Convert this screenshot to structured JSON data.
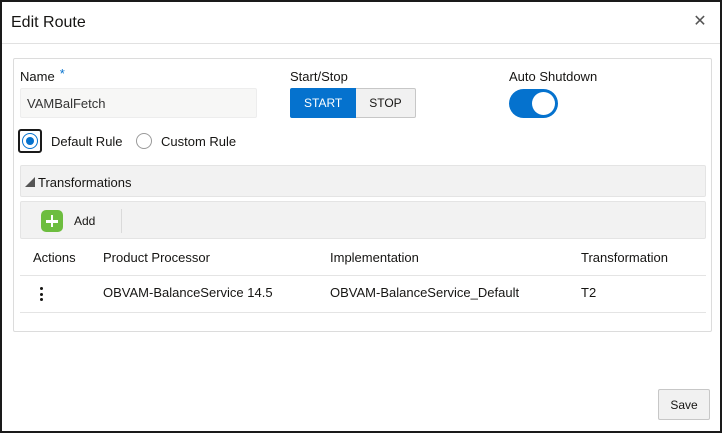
{
  "dialog": {
    "title": "Edit Route",
    "close_icon": "close-icon",
    "close_glyph": "✕"
  },
  "form": {
    "name_label": "Name",
    "required_mark": "*",
    "name_value": "VAMBalFetch",
    "start_stop_label": "Start/Stop",
    "start_label": "START",
    "stop_label": "STOP",
    "start_selected": true,
    "auto_shutdown_label": "Auto Shutdown",
    "auto_shutdown_on": true,
    "rule_options": [
      {
        "label": "Default Rule",
        "checked": true
      },
      {
        "label": "Custom Rule",
        "checked": false
      }
    ]
  },
  "transformations": {
    "section_title": "Transformations",
    "expanded": true,
    "add_label": "Add",
    "add_icon": "plus-icon",
    "columns": [
      "Actions",
      "Product Processor",
      "Implementation",
      "Transformation"
    ],
    "rows": [
      {
        "actions_icon": "kebab-menu-icon",
        "product_processor": "OBVAM-BalanceService 14.5",
        "implementation": "OBVAM-BalanceService_Default",
        "transformation": "T2"
      }
    ]
  },
  "footer": {
    "save_label": "Save"
  },
  "colors": {
    "accent": "#0572ce",
    "add_green": "#6dbd3f"
  }
}
